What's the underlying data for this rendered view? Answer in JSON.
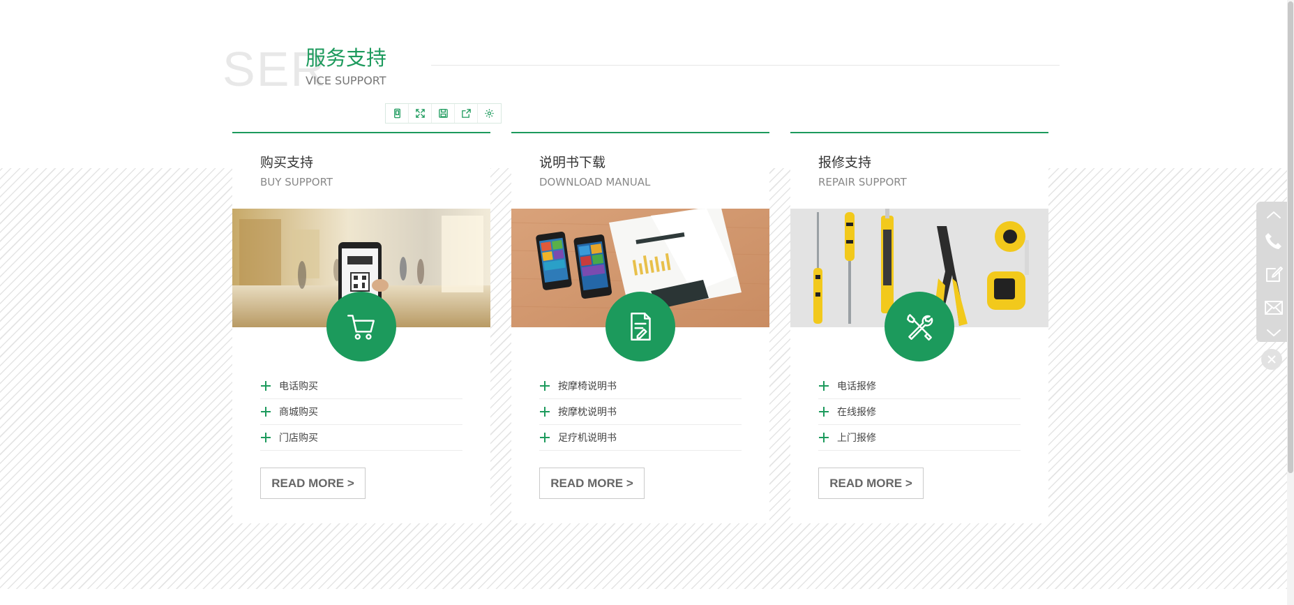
{
  "section": {
    "bg_word": "SER",
    "title_cn": "服务支持",
    "title_en": "VICE SUPPORT"
  },
  "toolbar": {
    "buttons": [
      {
        "icon": "mobile-icon"
      },
      {
        "icon": "fullscreen-icon"
      },
      {
        "icon": "save-icon"
      },
      {
        "icon": "share-icon"
      },
      {
        "icon": "settings-icon"
      }
    ]
  },
  "cards": [
    {
      "title_cn": "购买支持",
      "title_en": "BUY SUPPORT",
      "image": "mall-phone-qr-image",
      "icon": "cart-icon",
      "links": [
        "电话购买",
        "商城购买",
        "门店购买"
      ],
      "read_more": "READ MORE >"
    },
    {
      "title_cn": "说明书下载",
      "title_en": "DOWNLOAD MANUAL",
      "image": "phones-documents-image",
      "icon": "document-icon",
      "links": [
        "按摩椅说明书",
        "按摩枕说明书",
        "足疗机说明书"
      ],
      "read_more": "READ MORE >"
    },
    {
      "title_cn": "报修支持",
      "title_en": "REPAIR SUPPORT",
      "image": "tools-image",
      "icon": "tools-icon",
      "links": [
        "电话报修",
        "在线报修",
        "上门报修"
      ],
      "read_more": "READ MORE >"
    }
  ],
  "float_bar": {
    "items": [
      "chevron-up-icon",
      "phone-icon",
      "edit-icon",
      "mail-icon",
      "chevron-down-icon"
    ],
    "close": "close-icon"
  },
  "colors": {
    "accent": "#1c9a5c",
    "stripe": "#e4e4e4",
    "float_bar": "#d9d9d9"
  }
}
